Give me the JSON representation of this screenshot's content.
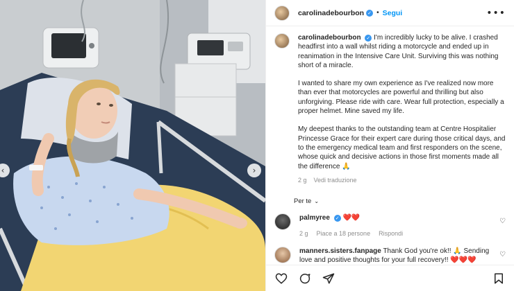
{
  "header": {
    "username": "carolinadebourbon",
    "separator": "•",
    "follow_label": "Segui",
    "more": "•••"
  },
  "caption": {
    "username": "carolinadebourbon",
    "paragraphs": [
      "I'm incredibly lucky to be alive. I crashed headfirst into a wall whilst riding a motorcycle and ended up in reanimation in the Intensive Care Unit. Surviving this was nothing short of a miracle.",
      "I wanted to share my own experience as I've realized now more than ever that motorcycles are powerful and thrilling but also unforgiving. Please ride with care. Wear full protection, especially a proper helmet. Mine saved my life.",
      "My deepest thanks to the outstanding team at Centre Hospitalier Princesse Grace for their expert care during those critical days, and to the emergency medical team and first responders on the scene, whose quick and decisive actions in those first moments made all the difference 🙏"
    ],
    "time": "2 g",
    "translate": "Vedi traduzione"
  },
  "per_te": "Per te",
  "comments": [
    {
      "username": "palmyree",
      "text": "❤️❤️",
      "time": "2 g",
      "likes": "Piace a 18 persone",
      "reply": "Rispondi"
    },
    {
      "username": "manners.sisters.fanpage",
      "text": "Thank God you're ok!! 🙏 Sending love and positive thoughts for your full recovery!! ❤️❤️❤️"
    }
  ],
  "icons": {
    "nav_left": "‹",
    "nav_right": "›",
    "like": "heart-icon",
    "comment": "comment-icon",
    "share": "share-icon",
    "save": "bookmark-icon"
  },
  "colors": {
    "accent": "#0095f6",
    "verified": "#3897f0",
    "muted": "#8e8e8e"
  }
}
